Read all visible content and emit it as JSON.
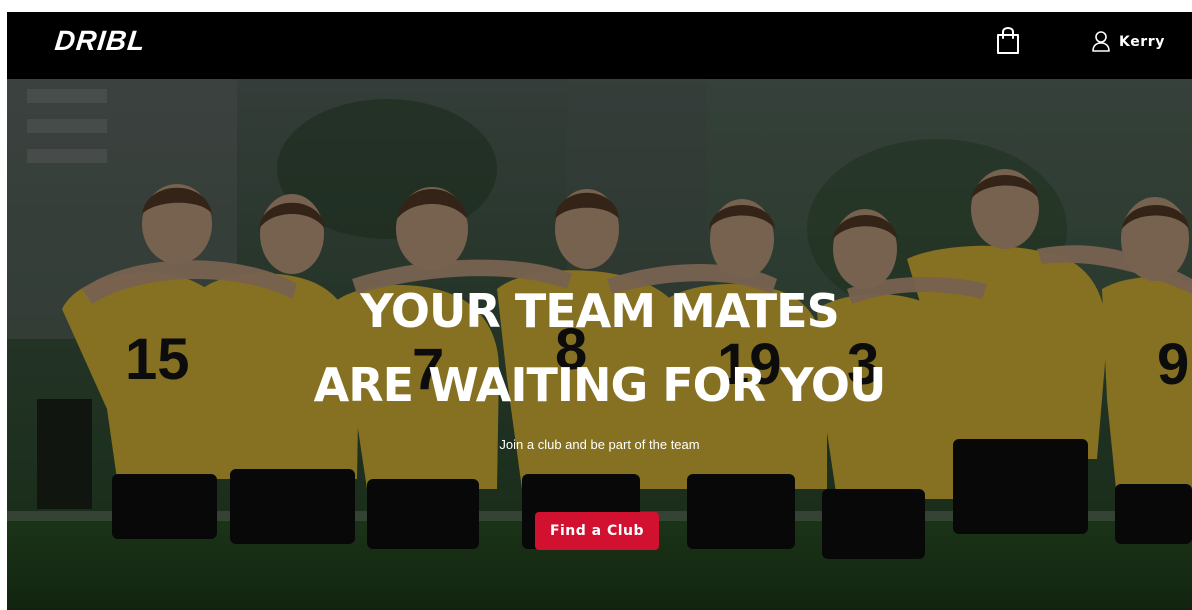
{
  "header": {
    "logo": "DRIBL",
    "user_name": "Kerry",
    "bag_icon": "shopping-bag-icon",
    "user_icon": "user-icon"
  },
  "hero": {
    "headline_line1": "YOUR TEAM MATES",
    "headline_line2": "ARE WAITING FOR YOU",
    "subtitle": "Join a club and be part of the team",
    "cta_label": "Find a Club",
    "background_image": "youth soccer team in yellow jerseys huddled arm in arm, seen from behind",
    "jersey_numbers": [
      "15",
      "7",
      "8",
      "19",
      "3",
      "9"
    ]
  },
  "colors": {
    "header_bg": "#000000",
    "accent": "#d2102f",
    "text": "#ffffff",
    "jersey": "#e5c33a"
  }
}
